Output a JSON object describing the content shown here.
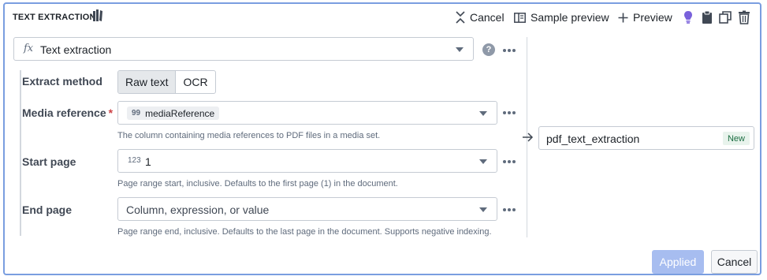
{
  "header": {
    "title": "TEXT EXTRACTION",
    "cancel_label": "Cancel",
    "sample_preview_label": "Sample preview",
    "preview_label": "Preview"
  },
  "function": {
    "name": "Text extraction",
    "prefix": "fx",
    "help": "?"
  },
  "params": {
    "extract_method": {
      "label": "Extract method",
      "options": [
        "Raw text",
        "OCR"
      ],
      "selected": "Raw text"
    },
    "media_reference": {
      "label": "Media reference",
      "required_mark": "*",
      "chip_prefix": "99",
      "value": "mediaReference",
      "help": "The column containing media references to PDF files in a media set."
    },
    "start_page": {
      "label": "Start page",
      "type_prefix": "123",
      "value": "1",
      "help": "Page range start, inclusive. Defaults to the first page (1) in the document."
    },
    "end_page": {
      "label": "End page",
      "placeholder": "Column, expression, or value",
      "help": "Page range end, inclusive. Defaults to the last page in the document. Supports negative indexing."
    }
  },
  "output": {
    "column_name": "pdf_text_extraction",
    "badge": "New"
  },
  "footer": {
    "applied_label": "Applied",
    "cancel_label": "Cancel"
  },
  "colors": {
    "accent": "#7a9ee0",
    "applied_bg": "#a7bdf0",
    "lightbulb": "#7961db",
    "new_badge": "#1c6e42"
  }
}
